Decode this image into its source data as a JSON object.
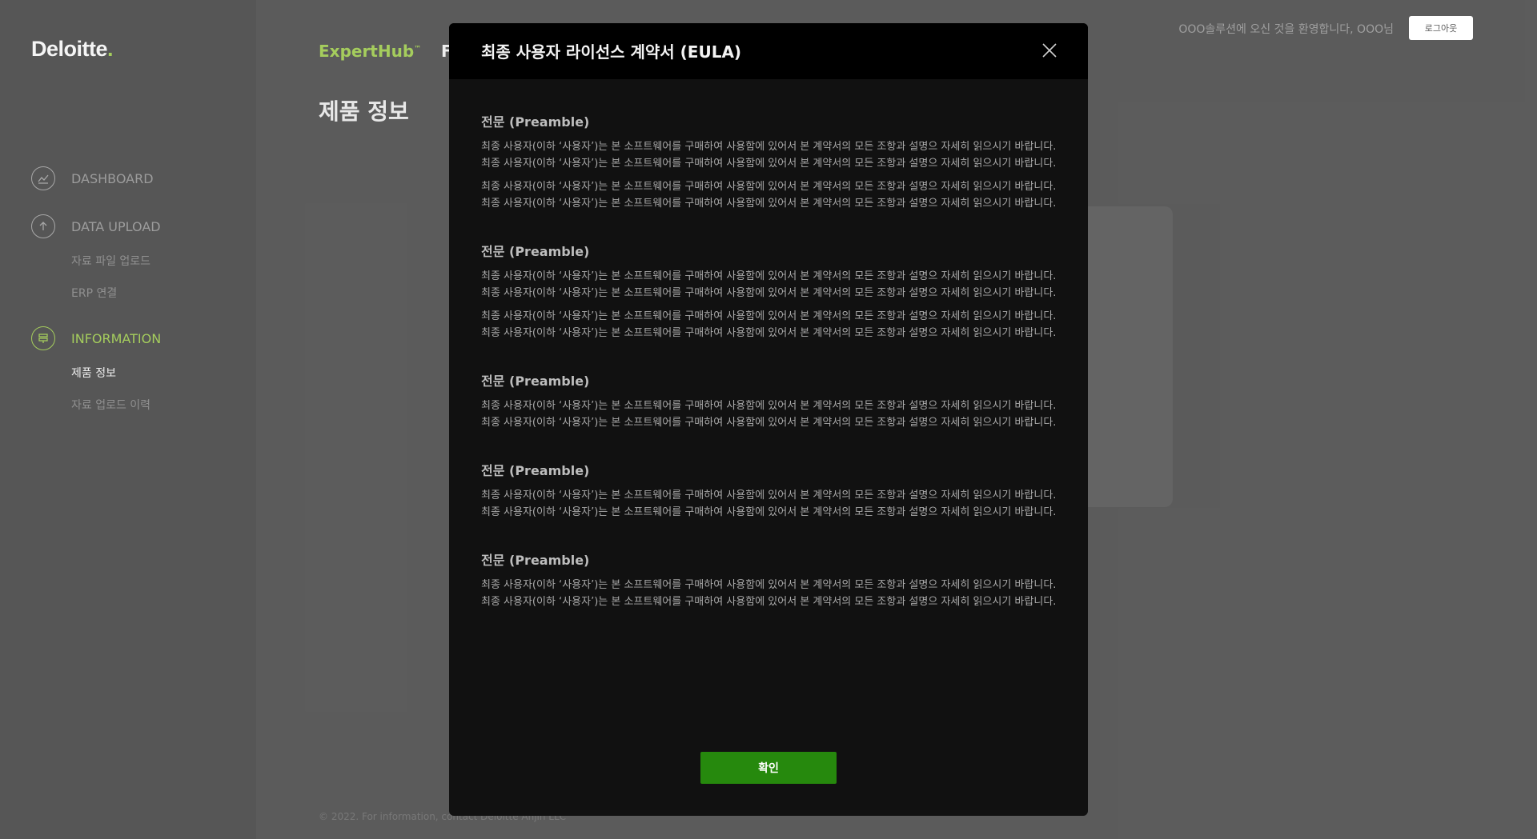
{
  "sidebar": {
    "logo_text": "Deloitte",
    "logo_dot": ".",
    "groups": [
      {
        "label": "DASHBOARD",
        "icon": "chart-line-icon",
        "subs": []
      },
      {
        "label": "DATA UPLOAD",
        "icon": "upload-icon",
        "subs": [
          "자료 파일 업로드",
          "ERP 연결"
        ]
      },
      {
        "label": "INFORMATION",
        "icon": "info-icon",
        "subs": [
          "제품 정보",
          "자료 업로드 이력"
        ]
      }
    ]
  },
  "header": {
    "brand": "ExpertHub",
    "brand_tm": "™",
    "brand_after": "F",
    "page_title": "제품 정보",
    "welcome": "OOO솔루션에 오신 것을 환영합니다, OOO님",
    "logout_label": "로그아웃"
  },
  "footer": {
    "text": "© 2022. For information, contact Deloitte Anjin LLC"
  },
  "modal": {
    "title": "최종 사용자 라이선스 계약서 (EULA)",
    "confirm_label": "확인",
    "sections": [
      {
        "title": "전문 (Preamble)",
        "paragraphs": [
          "최종 사용자(이하 ‘사용자’)는 본 소프트웨어를 구매하여 사용함에 있어서 본 계약서의 모든 조항과 설명으 자세히 읽으시기 바랍니다. 최종 사용자(이하 ‘사용자’)는 본 소프트웨어를 구매하여 사용함에 있어서 본 계약서의 모든 조항과 설명으 자세히 읽으시기 바랍니다.",
          "최종 사용자(이하 ‘사용자’)는 본 소프트웨어를 구매하여 사용함에 있어서 본 계약서의 모든 조항과 설명으 자세히 읽으시기 바랍니다. 최종 사용자(이하 ‘사용자’)는 본 소프트웨어를 구매하여 사용함에 있어서 본 계약서의 모든 조항과 설명으 자세히 읽으시기 바랍니다."
        ]
      },
      {
        "title": "전문 (Preamble)",
        "paragraphs": [
          "최종 사용자(이하 ‘사용자’)는 본 소프트웨어를 구매하여 사용함에 있어서 본 계약서의 모든 조항과 설명으 자세히 읽으시기 바랍니다. 최종 사용자(이하 ‘사용자’)는 본 소프트웨어를 구매하여 사용함에 있어서 본 계약서의 모든 조항과 설명으 자세히 읽으시기 바랍니다.",
          "최종 사용자(이하 ‘사용자’)는 본 소프트웨어를 구매하여 사용함에 있어서 본 계약서의 모든 조항과 설명으 자세히 읽으시기 바랍니다. 최종 사용자(이하 ‘사용자’)는 본 소프트웨어를 구매하여 사용함에 있어서 본 계약서의 모든 조항과 설명으 자세히 읽으시기 바랍니다."
        ]
      },
      {
        "title": "전문 (Preamble)",
        "paragraphs": [
          "최종 사용자(이하 ‘사용자’)는 본 소프트웨어를 구매하여 사용함에 있어서 본 계약서의 모든 조항과 설명으 자세히 읽으시기 바랍니다. 최종 사용자(이하 ‘사용자’)는 본 소프트웨어를 구매하여 사용함에 있어서 본 계약서의 모든 조항과 설명으 자세히 읽으시기 바랍니다."
        ]
      },
      {
        "title": "전문 (Preamble)",
        "paragraphs": [
          "최종 사용자(이하 ‘사용자’)는 본 소프트웨어를 구매하여 사용함에 있어서 본 계약서의 모든 조항과 설명으 자세히 읽으시기 바랍니다. 최종 사용자(이하 ‘사용자’)는 본 소프트웨어를 구매하여 사용함에 있어서 본 계약서의 모든 조항과 설명으 자세히 읽으시기 바랍니다."
        ]
      },
      {
        "title": "전문 (Preamble)",
        "paragraphs": [
          "최종 사용자(이하 ‘사용자’)는 본 소프트웨어를 구매하여 사용함에 있어서 본 계약서의 모든 조항과 설명으 자세히 읽으시기 바랍니다. 최종 사용자(이하 ‘사용자’)는 본 소프트웨어를 구매하여 사용함에 있어서 본 계약서의 모든 조항과 설명으 자세히 읽으시기 바랍니다."
        ]
      }
    ]
  },
  "colors": {
    "accent": "#86bc25",
    "confirm": "#26890d",
    "modal_bg": "#111111",
    "modal_header": "#000000"
  }
}
